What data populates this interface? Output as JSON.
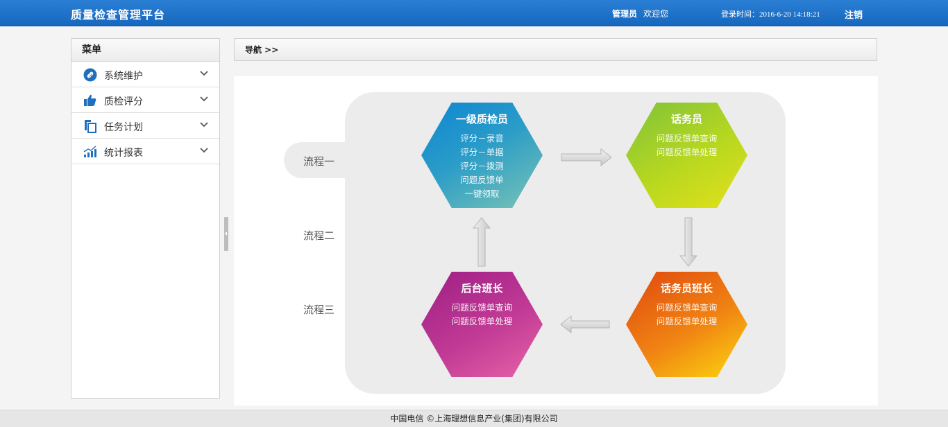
{
  "header": {
    "app_title": "质量检查管理平台",
    "user_role": "管理员",
    "welcome": "欢迎您",
    "login_time": "登录时间：2016-6-20 14:18:21",
    "logout_label": "注销"
  },
  "sidebar": {
    "title": "菜单",
    "items": [
      {
        "label": "系统维护",
        "icon": "link-icon"
      },
      {
        "label": "质检评分",
        "icon": "thumbs-up-icon"
      },
      {
        "label": "任务计划",
        "icon": "copy-icon"
      },
      {
        "label": "统计报表",
        "icon": "bar-chart-icon"
      }
    ]
  },
  "breadcrumb": {
    "text": "导航 >>"
  },
  "flow": {
    "labels": [
      "流程一",
      "流程二",
      "流程三"
    ],
    "nodes": {
      "qc": {
        "title": "一级质检员",
        "lines": [
          "评分－录音",
          "评分－单据",
          "评分－拨测",
          "问题反馈单",
          "一键领取"
        ]
      },
      "agent": {
        "title": "话务员",
        "lines": [
          "问题反馈单查询",
          "问题反馈单处理"
        ]
      },
      "agent_lead": {
        "title": "话务员班长",
        "lines": [
          "问题反馈单查询",
          "问题反馈单处理"
        ]
      },
      "backend_lead": {
        "title": "后台班长",
        "lines": [
          "问题反馈单查询",
          "问题反馈单处理"
        ]
      }
    }
  },
  "footer": {
    "text": "中国电信  ©上海理想信息产业(集团)有限公司"
  },
  "colors": {
    "header": "#1f73c9",
    "icon_blue": "#1f6fbf",
    "hex_qc": "#0d86d2",
    "hex_agent": "#b9d81f",
    "hex_agent_lead": "#f08413",
    "hex_backend_lead": "#c13a95"
  }
}
